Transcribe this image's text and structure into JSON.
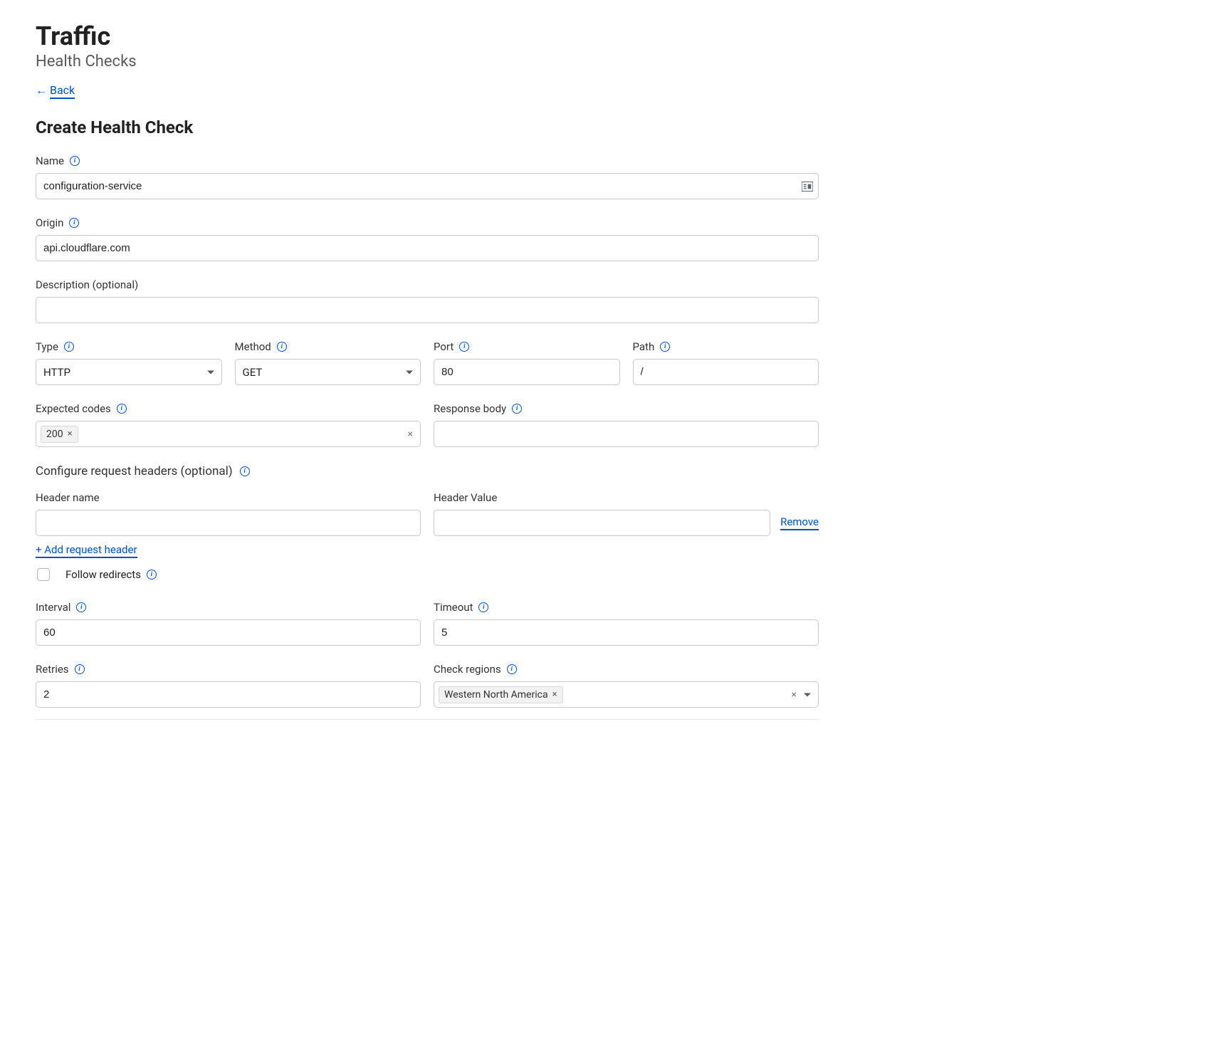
{
  "page": {
    "title": "Traffic",
    "subtitle": "Health Checks"
  },
  "nav": {
    "back": "Back"
  },
  "form": {
    "heading": "Create Health Check",
    "labels": {
      "name": "Name",
      "origin": "Origin",
      "description": "Description (optional)",
      "type": "Type",
      "method": "Method",
      "port": "Port",
      "path": "Path",
      "expected_codes": "Expected codes",
      "response_body": "Response body",
      "configure_headers": "Configure request headers (optional)",
      "header_name": "Header name",
      "header_value": "Header Value",
      "remove": "Remove",
      "add_header": "+ Add request header",
      "follow_redirects": "Follow redirects",
      "interval": "Interval",
      "timeout": "Timeout",
      "retries": "Retries",
      "check_regions": "Check regions"
    },
    "values": {
      "name": "configuration-service",
      "origin": "api.cloudflare.com",
      "description": "",
      "type": "HTTP",
      "method": "GET",
      "port": "80",
      "path": "/",
      "expected_codes": [
        "200"
      ],
      "response_body": "",
      "header_name": "",
      "header_value": "",
      "follow_redirects": false,
      "interval": "60",
      "timeout": "5",
      "retries": "2",
      "check_regions": [
        "Western North America"
      ]
    }
  }
}
